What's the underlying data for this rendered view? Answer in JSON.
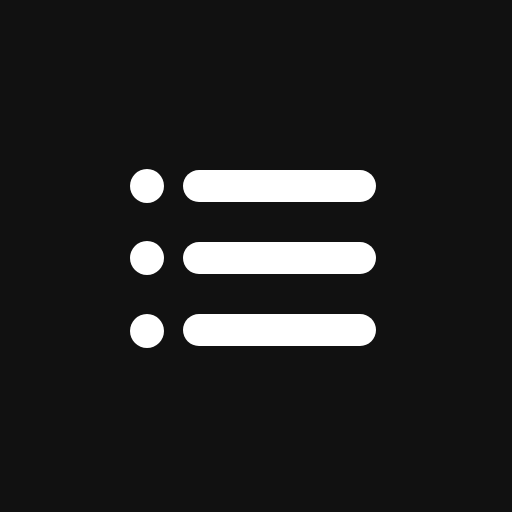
{
  "icon": {
    "name": "list-icon",
    "rows": 3
  },
  "colors": {
    "background": "#111111",
    "foreground": "#ffffff"
  }
}
